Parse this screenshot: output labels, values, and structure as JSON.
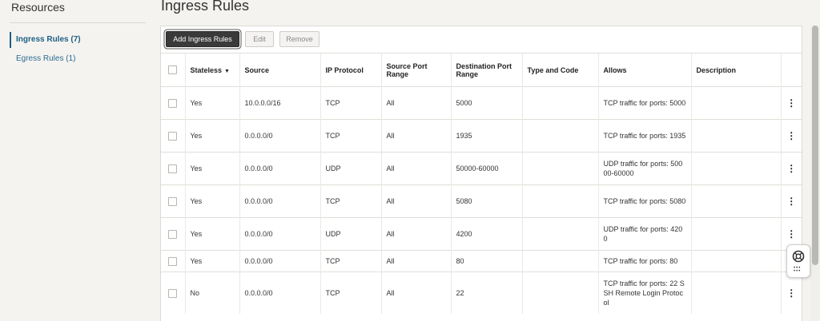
{
  "sidebar": {
    "title": "Resources",
    "items": [
      {
        "label": "Ingress Rules (7)",
        "active": true
      },
      {
        "label": "Egress Rules (1)",
        "active": false
      }
    ]
  },
  "page": {
    "title": "Ingress Rules"
  },
  "toolbar": {
    "add_label": "Add Ingress Rules",
    "edit_label": "Edit",
    "remove_label": "Remove"
  },
  "table": {
    "headers": {
      "stateless": "Stateless",
      "source": "Source",
      "protocol": "IP Protocol",
      "src_port": "Source Port Range",
      "dst_port": "Destination Port Range",
      "type_code": "Type and Code",
      "allows": "Allows",
      "description": "Description"
    },
    "rows": [
      {
        "stateless": "Yes",
        "source": "10.0.0.0/16",
        "protocol": "TCP",
        "src_port": "All",
        "dst_port": "5000",
        "type_code": "",
        "allows": "TCP traffic for ports: 5000",
        "description": ""
      },
      {
        "stateless": "Yes",
        "source": "0.0.0.0/0",
        "protocol": "TCP",
        "src_port": "All",
        "dst_port": "1935",
        "type_code": "",
        "allows": "TCP traffic for ports: 1935",
        "description": ""
      },
      {
        "stateless": "Yes",
        "source": "0.0.0.0/0",
        "protocol": "UDP",
        "src_port": "All",
        "dst_port": "50000-60000",
        "type_code": "",
        "allows": "UDP traffic for ports: 50000-60000",
        "description": ""
      },
      {
        "stateless": "Yes",
        "source": "0.0.0.0/0",
        "protocol": "TCP",
        "src_port": "All",
        "dst_port": "5080",
        "type_code": "",
        "allows": "TCP traffic for ports: 5080",
        "description": ""
      },
      {
        "stateless": "Yes",
        "source": "0.0.0.0/0",
        "protocol": "UDP",
        "src_port": "All",
        "dst_port": "4200",
        "type_code": "",
        "allows": "UDP traffic for ports: 4200",
        "description": ""
      },
      {
        "stateless": "Yes",
        "source": "0.0.0.0/0",
        "protocol": "TCP",
        "src_port": "All",
        "dst_port": "80",
        "type_code": "",
        "allows": "TCP traffic for ports: 80",
        "description": ""
      },
      {
        "stateless": "No",
        "source": "0.0.0.0/0",
        "protocol": "TCP",
        "src_port": "All",
        "dst_port": "22",
        "type_code": "",
        "allows": "TCP traffic for ports: 22 SSH Remote Login Protocol",
        "description": ""
      }
    ]
  },
  "icons": {
    "sort": "sort-descending-icon",
    "row_menu": "kebab-menu-icon",
    "help": "lifering-help-icon",
    "apps": "app-grid-icon"
  },
  "colors": {
    "primary_button": "#3a3a3a",
    "link": "#2c6d8e"
  }
}
